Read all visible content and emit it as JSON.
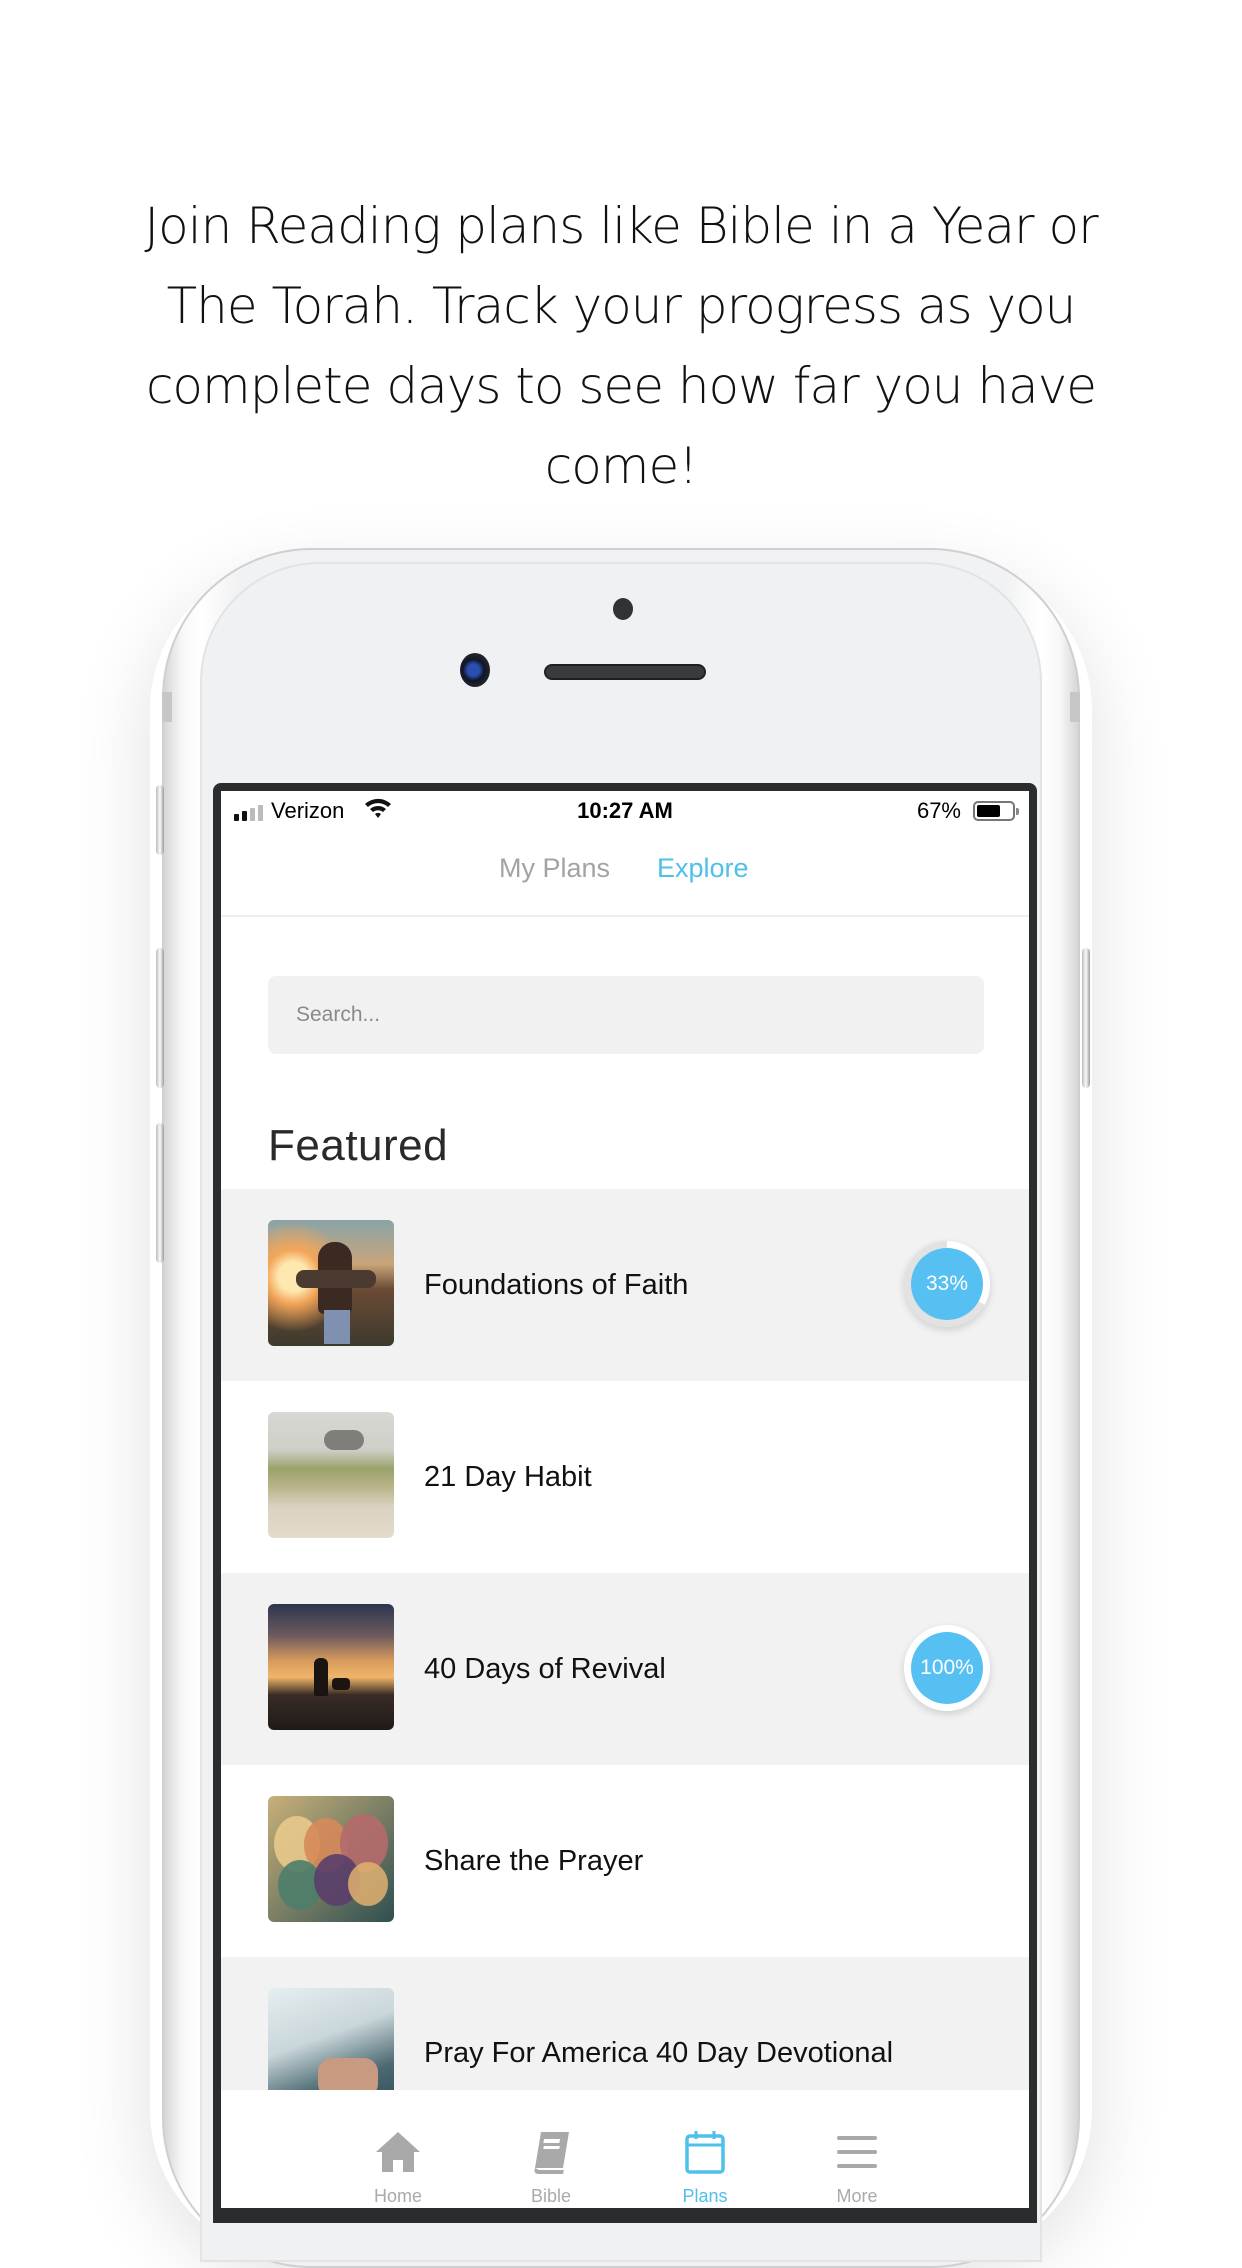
{
  "headline": "Join Reading plans like Bible in a Year or The Torah. Track your progress as you complete days to see how far you have come!",
  "colors": {
    "accent": "#4fc0e8",
    "badge_fill": "#56c0f3",
    "row_alt_bg": "#f2f2f2",
    "inactive": "#aaaaaa"
  },
  "status_bar": {
    "carrier": "Verizon",
    "signal_bars": 2,
    "time": "10:27 AM",
    "battery_percent_label": "67%",
    "battery_level": 0.67
  },
  "top_tabs": [
    {
      "label": "My Plans",
      "active": false
    },
    {
      "label": "Explore",
      "active": true
    }
  ],
  "search": {
    "placeholder": "Search...",
    "value": ""
  },
  "section_title": "Featured",
  "plans": [
    {
      "title": "Foundations of Faith",
      "thumbnail": "person-sunset-photo",
      "progress": 0.33,
      "progress_label": "33%"
    },
    {
      "title": "21 Day Habit",
      "thumbnail": "sand-dunes-grass-photo",
      "progress": null,
      "progress_label": null
    },
    {
      "title": "40 Days of Revival",
      "thumbnail": "silhouette-dog-sunset-photo",
      "progress": 1.0,
      "progress_label": "100%"
    },
    {
      "title": "Share the Prayer",
      "thumbnail": "balloons-photo",
      "progress": null,
      "progress_label": null
    },
    {
      "title": "Pray For America 40 Day Devotional",
      "thumbnail": "hands-laptop-photo",
      "progress": null,
      "progress_label": null
    }
  ],
  "bottom_tabs": [
    {
      "label": "Home",
      "icon": "home-icon",
      "active": false
    },
    {
      "label": "Bible",
      "icon": "book-icon",
      "active": false
    },
    {
      "label": "Plans",
      "icon": "calendar-icon",
      "active": true
    },
    {
      "label": "More",
      "icon": "menu-icon",
      "active": false
    }
  ]
}
